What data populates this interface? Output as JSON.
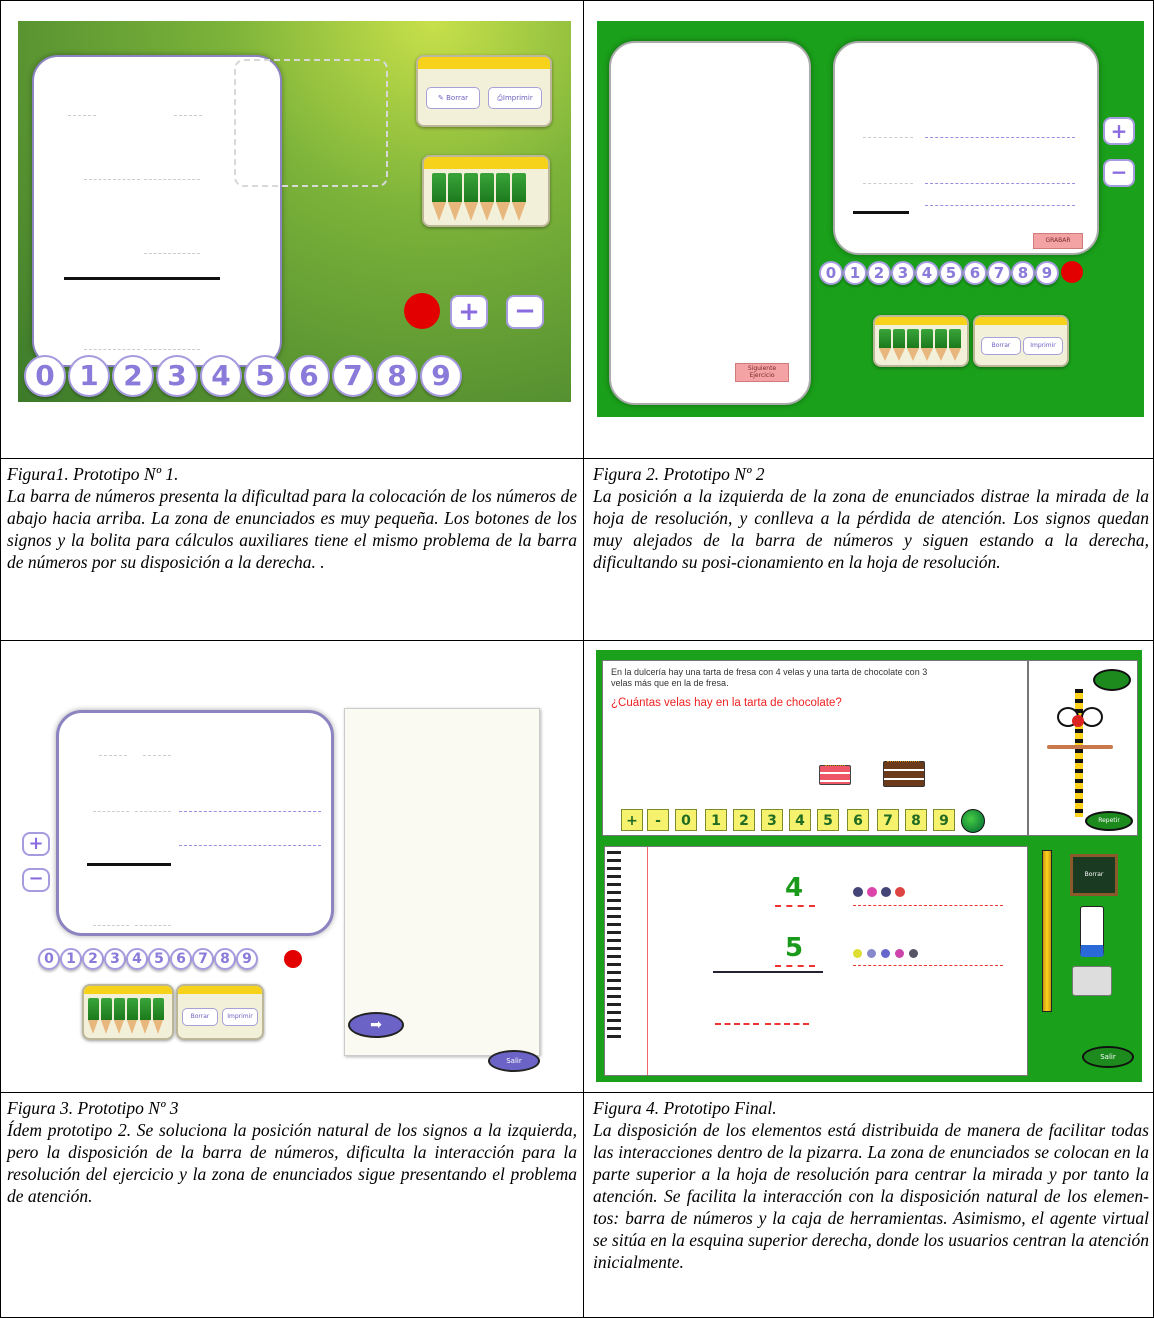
{
  "figures": [
    {
      "title": "Figura1. Prototipo Nº 1.",
      "text": "La barra de números presenta la dificultad para la colocación de los números de abajo hacia arriba. La zona de enunciados es muy pequeña. Los botones de los signos y la bolita para cálculos auxiliares tiene el mismo problema de la barra de números por su disposición a la derecha. .",
      "buttons": {
        "borrar": "Borrar",
        "imprimir": "Imprimir"
      },
      "numbers": [
        "0",
        "1",
        "2",
        "3",
        "4",
        "5",
        "6",
        "7",
        "8",
        "9"
      ],
      "signs": {
        "plus": "+",
        "minus": "−"
      }
    },
    {
      "title": "Figura 2. Prototipo Nº 2",
      "text": "La posición a la izquierda de la zona de enunciados distrae la mirada de la hoja de resolución, y conlleva a la pérdida de atención. Los signos quedan muy alejados de la barra de números y siguen estando a la derecha, dificultando su posi-cionamiento en la hoja de resolución.",
      "buttons": {
        "siguiente": "Siguiente Ejercicio",
        "grabar": "GRABAR",
        "borrar": "Borrar",
        "imprimir": "Imprimir"
      },
      "numbers": [
        "0",
        "1",
        "2",
        "3",
        "4",
        "5",
        "6",
        "7",
        "8",
        "9"
      ],
      "signs": {
        "plus": "+",
        "minus": "−"
      }
    },
    {
      "title": "Figura 3. Prototipo Nº 3",
      "text": "Ídem prototipo 2. Se soluciona la posición natural de los signos a la izquierda, pero la disposición de la barra de números, dificulta la interacción para la resolución del ejercicio y la zona de enunciados sigue presentando el problema de atención.",
      "buttons": {
        "salir": "Salir",
        "borrar": "Borrar",
        "imprimir": "Imprimir"
      },
      "numbers": [
        "0",
        "1",
        "2",
        "3",
        "4",
        "5",
        "6",
        "7",
        "8",
        "9"
      ],
      "signs": {
        "plus": "+",
        "minus": "−"
      }
    },
    {
      "title": "Figura 4. Prototipo Final.",
      "text": "La disposición de los elementos está distribuida de manera de facilitar todas las interacciones dentro de la pizarra. La zona de enunciados se colocan en la parte superior a la hoja de resolución para centrar la mirada y por tanto la atención. Se facilita la interacción con la disposición natural de los elemen-tos: barra de números y la caja de herramientas. Asimismo, el agente virtual se sitúa en la esquina superior derecha, donde los usuarios centran la atención inicialmente.",
      "problem_line1": "En la dulcería hay una tarta de fresa con 4 velas y una tarta de chocolate con 3",
      "problem_line2": "velas más que en la de fresa.",
      "question": "¿Cuántas velas hay en la tarta de chocolate?",
      "keys": [
        "+",
        "-",
        "0",
        "1",
        "2",
        "3",
        "4",
        "5",
        "6",
        "7",
        "8",
        "9"
      ],
      "repetir": "Repetir",
      "salir": "Salir",
      "borrar": "Borrar",
      "operand1": "4",
      "operand2": "5"
    }
  ]
}
